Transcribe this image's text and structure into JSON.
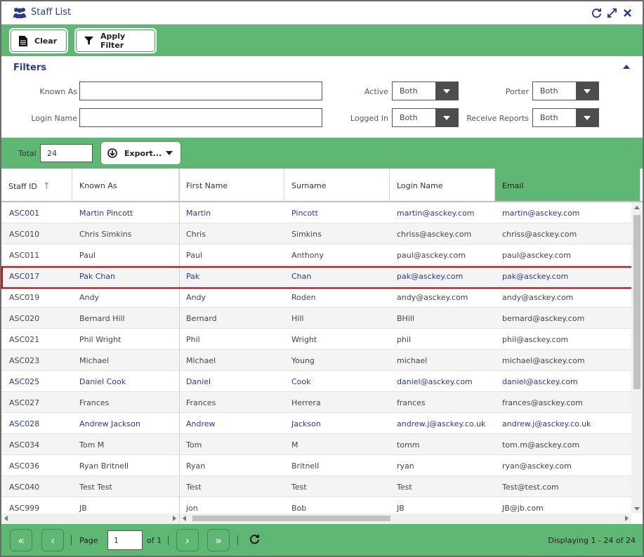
{
  "window": {
    "title": "Staff List",
    "icon": "users-icon",
    "actions": [
      "refresh-icon",
      "expand-icon",
      "close-icon"
    ]
  },
  "toolbar": {
    "clear_label": "Clear",
    "apply_filter_label": "Apply Filter"
  },
  "filters": {
    "title": "Filters",
    "known_as_label": "Known As",
    "known_as_value": "",
    "login_name_label": "Login Name",
    "login_name_value": "",
    "active_label": "Active",
    "active_value": "Both",
    "logged_in_label": "Logged In",
    "logged_in_value": "Both",
    "porter_label": "Porter",
    "porter_value": "Both",
    "receive_reports_label": "Receive Reports",
    "receive_reports_value": "Both"
  },
  "gridbar": {
    "total_label": "Total",
    "total_value": "24",
    "export_label": "Export..."
  },
  "table": {
    "columns": [
      "Staff ID",
      "Known As",
      "First Name",
      "Surname",
      "Login Name",
      "Email"
    ],
    "sorted_column": "Staff ID",
    "rows": [
      {
        "id": "ASC001",
        "known": "Martin Pincott",
        "first": "Martin",
        "surname": "Pincott",
        "login": "martin@asckey.com",
        "email": "martin@asckey.com",
        "blue": true
      },
      {
        "id": "ASC010",
        "known": "Chris Simkins",
        "first": "Chris",
        "surname": "Simkins",
        "login": "chriss@asckey.com",
        "email": "chriss@asckey.com",
        "blue": false
      },
      {
        "id": "ASC011",
        "known": "Paul",
        "first": "Paul",
        "surname": "Anthony",
        "login": "paul@asckey.com",
        "email": "paul@asckey.com",
        "blue": false
      },
      {
        "id": "ASC017",
        "known": "Pak Chan",
        "first": "Pak",
        "surname": "Chan",
        "login": "pak@asckey.com",
        "email": "pak@asckey.com",
        "blue": true
      },
      {
        "id": "ASC019",
        "known": "Andy",
        "first": "Andy",
        "surname": "Roden",
        "login": "andy@asckey.com",
        "email": "andy@asckey.com",
        "blue": false
      },
      {
        "id": "ASC020",
        "known": "Bernard Hill",
        "first": "Bernard",
        "surname": "Hill",
        "login": "BHill",
        "email": "bernard@asckey.com",
        "blue": false
      },
      {
        "id": "ASC021",
        "known": "Phil Wright",
        "first": "Phil",
        "surname": "Wright",
        "login": "phil",
        "email": "phil@asckey.com",
        "blue": false
      },
      {
        "id": "ASC023",
        "known": "Michael",
        "first": "Michael",
        "surname": "Young",
        "login": "michael",
        "email": "michael@asckey.com",
        "blue": false
      },
      {
        "id": "ASC025",
        "known": "Daniel Cook",
        "first": "Daniel",
        "surname": "Cook",
        "login": "daniel@asckey.com",
        "email": "daniel@asckey.com",
        "blue": true
      },
      {
        "id": "ASC027",
        "known": "Frances",
        "first": "Frances",
        "surname": "Herrera",
        "login": "frances",
        "email": "frances@asckey.com",
        "blue": false
      },
      {
        "id": "ASC028",
        "known": "Andrew Jackson",
        "first": "Andrew",
        "surname": "Jackson",
        "login": "andrew.j@asckey.co.uk",
        "email": "andrew.j@asckey.co.uk",
        "blue": true
      },
      {
        "id": "ASC034",
        "known": "Tom M",
        "first": "Tom",
        "surname": "M",
        "login": "tomm",
        "email": "tom.m@asckey.com",
        "blue": false
      },
      {
        "id": "ASC036",
        "known": "Ryan Britnell",
        "first": "Ryan",
        "surname": "Britnell",
        "login": "ryan",
        "email": "ryan@asckey.com",
        "blue": false
      },
      {
        "id": "ASC040",
        "known": "Test Test",
        "first": "Test",
        "surname": "Test",
        "login": "Test",
        "email": "Test@test.com",
        "blue": false
      },
      {
        "id": "ASC999",
        "known": "JB",
        "first": "jon",
        "surname": "Bob",
        "login": "JB",
        "email": "JB@jb.com",
        "blue": false
      }
    ],
    "selected_row": "ASC017"
  },
  "pager": {
    "page_label": "Page",
    "page_value": "1",
    "of_label": "of 1",
    "status": "Displaying 1 - 24 of 24"
  },
  "colors": {
    "accent_green": "#5fb774",
    "title_blue": "#2b3990",
    "selection_red": "#e00000"
  }
}
